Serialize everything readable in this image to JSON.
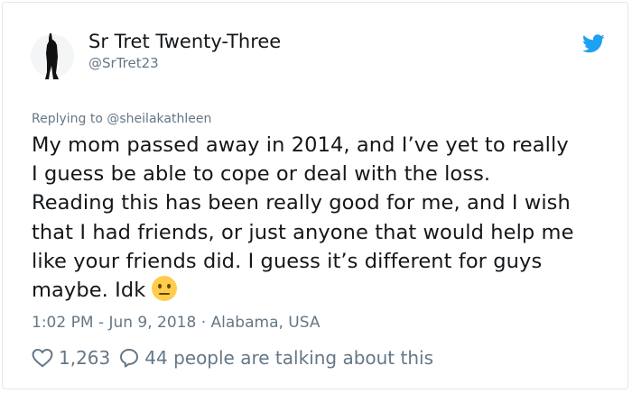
{
  "author": {
    "name": "Sr Tret Twenty-Three",
    "handle": "@SrTret23"
  },
  "reply": {
    "prefix": "Replying to",
    "user": "@sheilakathleen"
  },
  "tweet": {
    "lines": [
      "My mom passed away in 2014, and I’ve yet to really",
      "I guess be able to cope or deal with the loss.",
      "Reading this has been really good for me, and I wish",
      "that I had friends, or just anyone that would help me",
      "like your friends did. I guess it’s different for guys",
      "maybe. Idk"
    ],
    "emoji": "neutral-face-emoji"
  },
  "meta": {
    "time": "1:02 PM",
    "date": "Jun 9, 2018",
    "location": "Alabama, USA"
  },
  "stats": {
    "likes": "1,263",
    "talking": "44 people are talking about this"
  },
  "icons": {
    "brand": "twitter-bird-icon",
    "like": "heart-icon",
    "reply": "speech-bubble-icon"
  },
  "colors": {
    "twitter_blue": "#1da1f2",
    "secondary_text": "#657786",
    "primary_text": "#14171a",
    "emoji_yellow": "#ffcc4d"
  }
}
